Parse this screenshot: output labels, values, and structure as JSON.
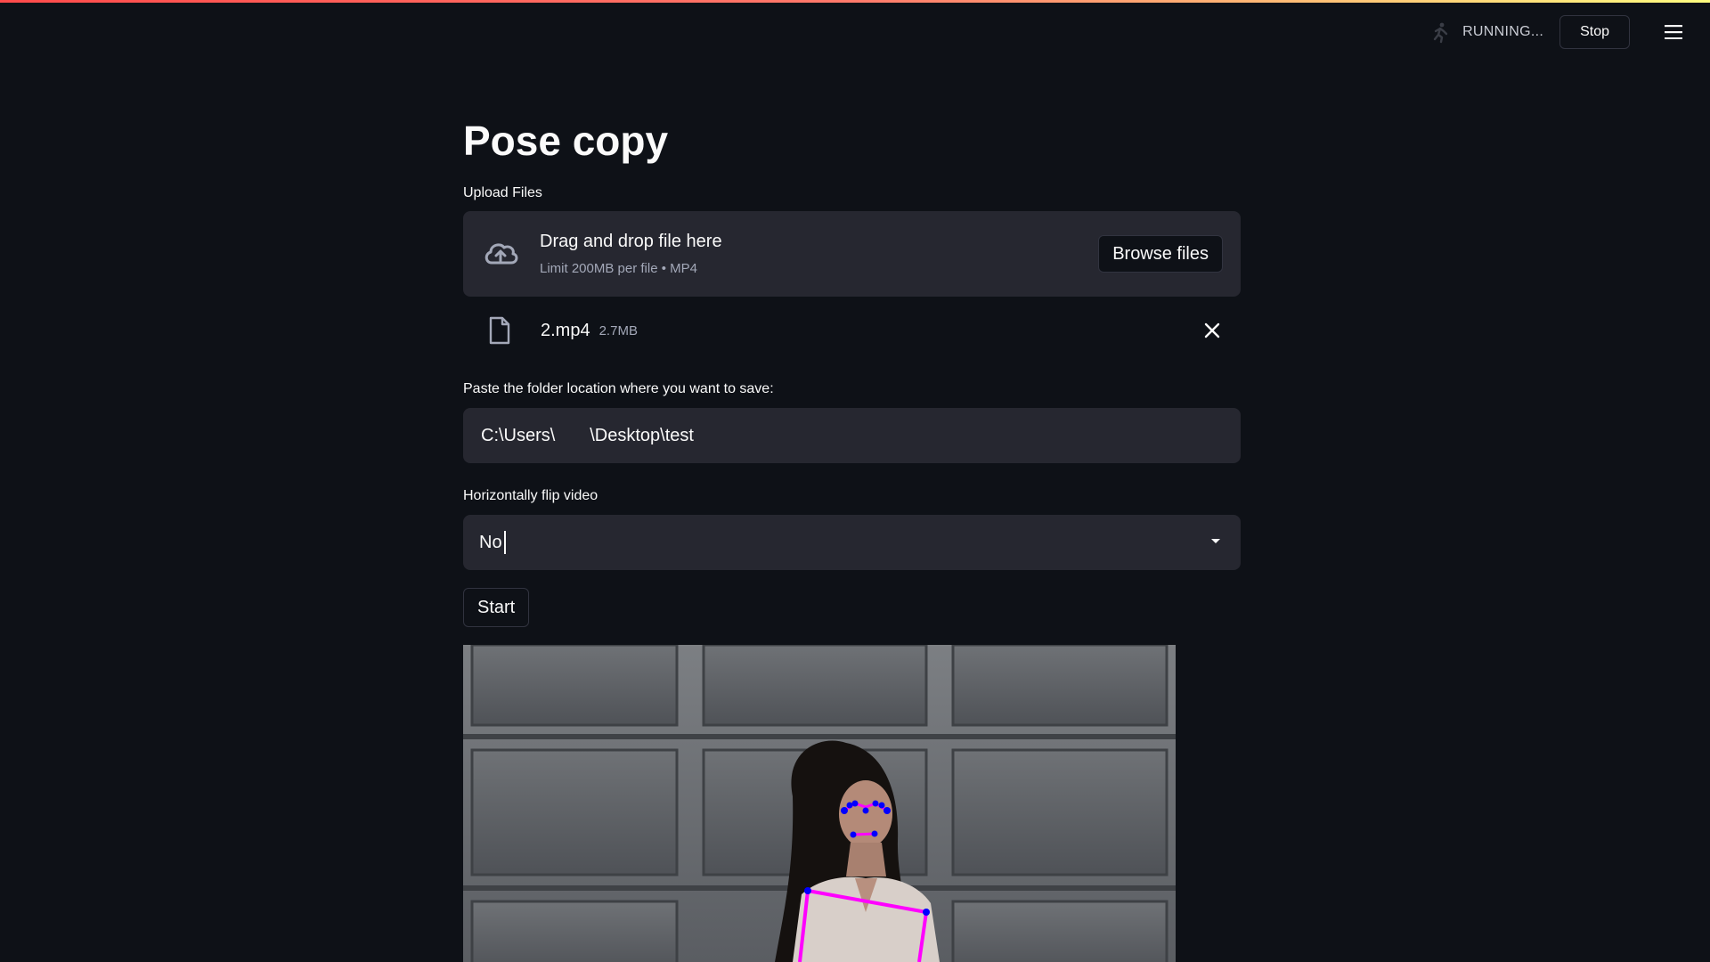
{
  "status": {
    "running_label": "RUNNING...",
    "stop_label": "Stop",
    "running_icon": "running-person-icon",
    "menu_icon": "hamburger-menu-icon"
  },
  "page": {
    "title": "Pose copy"
  },
  "uploader": {
    "label": "Upload Files",
    "dropzone_title": "Drag and drop file here",
    "dropzone_limit": "Limit 200MB per file • MP4",
    "browse_label": "Browse files",
    "upload_icon": "cloud-upload-icon"
  },
  "uploaded_file": {
    "name": "2.mp4",
    "size": "2.7MB",
    "file_icon": "file-icon",
    "remove_icon": "close-icon"
  },
  "folder_input": {
    "label": "Paste the folder location where you want to save:",
    "value": "C:\\Users\\       \\Desktop\\test"
  },
  "flip_select": {
    "label": "Horizontally flip video",
    "selected": "No",
    "arrow_icon": "chevron-down-icon"
  },
  "start_button": {
    "label": "Start"
  },
  "video": {
    "description_icon": "pose-estimation-video-frame"
  },
  "colors": {
    "background": "#0e1117",
    "input_bg": "#262730",
    "text": "#fafafa",
    "muted": "#a3a8b8",
    "pose_lines": "#ff00ff",
    "pose_points": "#0000ff"
  }
}
